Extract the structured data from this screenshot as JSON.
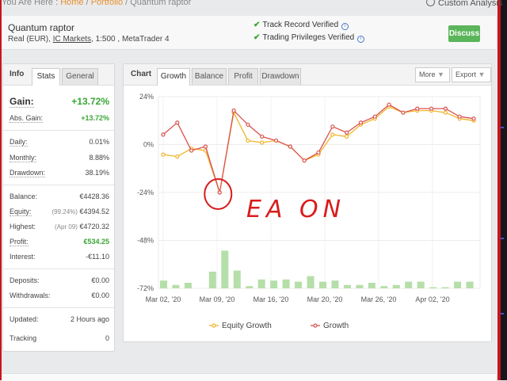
{
  "breadcrumb": {
    "prefix": "You Are Here : ",
    "home": "Home",
    "sep1": " / ",
    "portfolio": "Portfolio",
    "sep2": " / ",
    "current": "Quantum raptor"
  },
  "top_right": {
    "custom_analysis": "Custom Analysis"
  },
  "header": {
    "title": "Quantum raptor",
    "sub_a": "Real (EUR), ",
    "broker": "IC Markets",
    "sub_b": ", 1:500 , MetaTrader 4",
    "verified_1": "Track Record Verified",
    "verified_2": "Trading Privileges Verified",
    "discuss": "Discuss"
  },
  "info_panel": {
    "title": "Info",
    "tab_stats": "Stats",
    "tab_general": "General",
    "gain_label": "Gain:",
    "gain_value": "+13.72%",
    "abs_gain_label": "Abs. Gain:",
    "abs_gain_value": "+13.72%",
    "daily_label": "Daily:",
    "daily_value": "0.01%",
    "monthly_label": "Monthly:",
    "monthly_value": "8.88%",
    "drawdown_label": "Drawdown:",
    "drawdown_value": "38.19%",
    "balance_label": "Balance:",
    "balance_value": "€4428.36",
    "equity_label": "Equity:",
    "equity_note": "(99.24%)",
    "equity_value": "€4394.52",
    "highest_label": "Highest:",
    "highest_note": "(Apr 09)",
    "highest_value": "€4720.32",
    "profit_label": "Profit:",
    "profit_value": "€534.25",
    "interest_label": "Interest:",
    "interest_value": "-€11.10",
    "deposits_label": "Deposits:",
    "deposits_value": "€0.00",
    "withdrawals_label": "Withdrawals:",
    "withdrawals_value": "€0.00",
    "updated_label": "Updated:",
    "updated_value": "2 Hours ago",
    "tracking_label": "Tracking",
    "tracking_value": "0"
  },
  "chart_panel": {
    "title": "Chart",
    "tabs": [
      "Growth",
      "Balance",
      "Profit",
      "Drawdown"
    ],
    "more": "More",
    "export": "Export"
  },
  "annotation": {
    "text": "EA ON",
    "color": "#d81c1c"
  },
  "colors": {
    "growth": "#d9534f",
    "equity": "#f0b429",
    "bars": "#b5dfa9",
    "accent_green": "#3aa635",
    "frame": "#c8141e"
  },
  "chart_data": {
    "type": "line",
    "x_ticks": [
      "Mar 02, '20",
      "Mar 09, '20",
      "Mar 16, '20",
      "Mar 20, '20",
      "Mar 26, '20",
      "Apr 02, '20"
    ],
    "y_ticks": [
      "24%",
      "0%",
      "-24%",
      "-48%",
      "-72%"
    ],
    "ylim": [
      -72,
      24
    ],
    "grid": true,
    "legend_position": "bottom",
    "series": [
      {
        "name": "Equity Growth",
        "color": "#f0b429",
        "values": [
          -5,
          -6,
          -2,
          -3,
          -24,
          16,
          2,
          1,
          2,
          -1,
          -8,
          -5,
          5,
          4,
          10,
          13,
          19,
          16,
          17,
          17,
          16,
          13,
          12
        ]
      },
      {
        "name": "Growth",
        "color": "#d9534f",
        "values": [
          5,
          11,
          -3,
          -1,
          -24,
          17,
          10,
          4,
          2,
          -1,
          -8,
          -4,
          9,
          6,
          11,
          14,
          20,
          16,
          18,
          18,
          18,
          14,
          13
        ]
      }
    ],
    "bars": [
      3.5,
      1.5,
      2.5,
      0,
      7.5,
      17,
      8,
      1,
      4,
      3.5,
      4,
      3,
      5.5,
      3,
      3.5,
      1.5,
      1.5,
      2.5,
      1,
      1.5,
      3,
      3,
      0.5,
      0.5,
      3,
      3
    ]
  }
}
